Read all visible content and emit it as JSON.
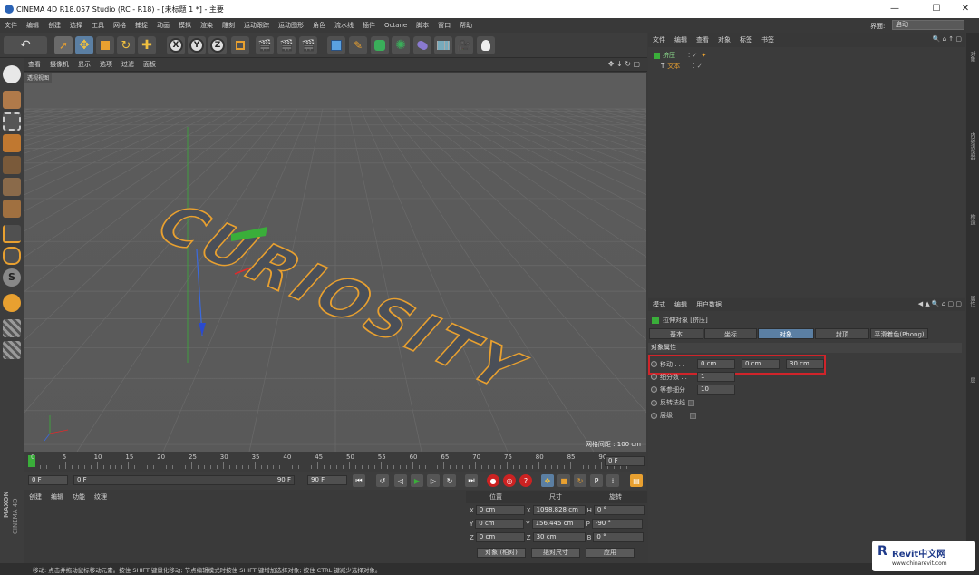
{
  "window": {
    "title": "CINEMA 4D R18.057 Studio (RC - R18) - [未标题 1 *] - 主要",
    "min": "—",
    "max": "☐",
    "close": "✕"
  },
  "menubar": {
    "items": [
      "文件",
      "编辑",
      "创建",
      "选择",
      "工具",
      "网格",
      "捕捉",
      "动画",
      "模拟",
      "渲染",
      "雕刻",
      "运动跟踪",
      "运动图形",
      "角色",
      "流水线",
      "插件",
      "Octane",
      "脚本",
      "窗口",
      "帮助"
    ],
    "layout_label": "界面:",
    "layout_value": "启动"
  },
  "viewport": {
    "menu": [
      "查看",
      "摄像机",
      "显示",
      "选项",
      "过滤",
      "面板"
    ],
    "label": "透视视图",
    "grid_spacing": "网格间距 : 100 cm",
    "text_object": "CURIOSITY"
  },
  "timeline": {
    "ticks": [
      "0",
      "5",
      "10",
      "15",
      "20",
      "25",
      "30",
      "35",
      "40",
      "45",
      "50",
      "55",
      "60",
      "65",
      "70",
      "75",
      "80",
      "85",
      "90"
    ],
    "frame_end": "0 F"
  },
  "playback": {
    "current": "0 F",
    "range_start": "0 F",
    "range_end": "90 F",
    "max": "90 F"
  },
  "material": {
    "menu": [
      "创建",
      "编辑",
      "功能",
      "纹理"
    ],
    "logo_top": "MAXON",
    "logo_bottom": "CINEMA 4D"
  },
  "coords": {
    "headers": [
      "位置",
      "尺寸",
      "旋转"
    ],
    "rows": [
      {
        "axis": "X",
        "pos": "0 cm",
        "s_axis": "X",
        "size": "1098.828 cm",
        "r_axis": "H",
        "rot": "0 °"
      },
      {
        "axis": "Y",
        "pos": "0 cm",
        "s_axis": "Y",
        "size": "156.445 cm",
        "r_axis": "P",
        "rot": "-90 °"
      },
      {
        "axis": "Z",
        "pos": "0 cm",
        "s_axis": "Z",
        "size": "30 cm",
        "r_axis": "B",
        "rot": "0 °"
      }
    ],
    "mode": "对象 (相对)",
    "size_mode": "绝对尺寸",
    "apply": "应用"
  },
  "object_manager": {
    "menu": [
      "文件",
      "编辑",
      "查看",
      "对象",
      "标签",
      "书签"
    ],
    "objects": [
      {
        "name": "挤压"
      },
      {
        "name": "文本"
      }
    ]
  },
  "attribute_manager": {
    "menu": [
      "模式",
      "编辑",
      "用户数据"
    ],
    "object_title": "拉伸对象 [挤压]",
    "tabs": [
      "基本",
      "坐标",
      "对象",
      "封顶",
      "平滑着色(Phong)"
    ],
    "section": "对象属性",
    "move_label": "移动 . . .",
    "move": [
      "0 cm",
      "0 cm",
      "30 cm"
    ],
    "subdiv_label": "细分数 . .",
    "subdiv": "1",
    "iso_label": "等参细分",
    "iso": "10",
    "flip_label": "反转法线",
    "hier_label": "层级"
  },
  "right_strip": [
    "对象",
    "内容浏览器",
    "构造",
    "属性",
    "层"
  ],
  "status": "移动: 点击并拖动鼠标移动元素。按住 SHIFT 键量化移动; 节点编辑模式时按住 SHIFT 键增加选择对象; 按住 CTRL 键减少选择对象。",
  "watermark": {
    "brand": "Revit中文网",
    "url": "www.chinarevit.com"
  },
  "colors": {
    "accent_blue": "#5b7fa3",
    "highlight_red": "#d0242a",
    "object_orange": "#e8a030"
  }
}
